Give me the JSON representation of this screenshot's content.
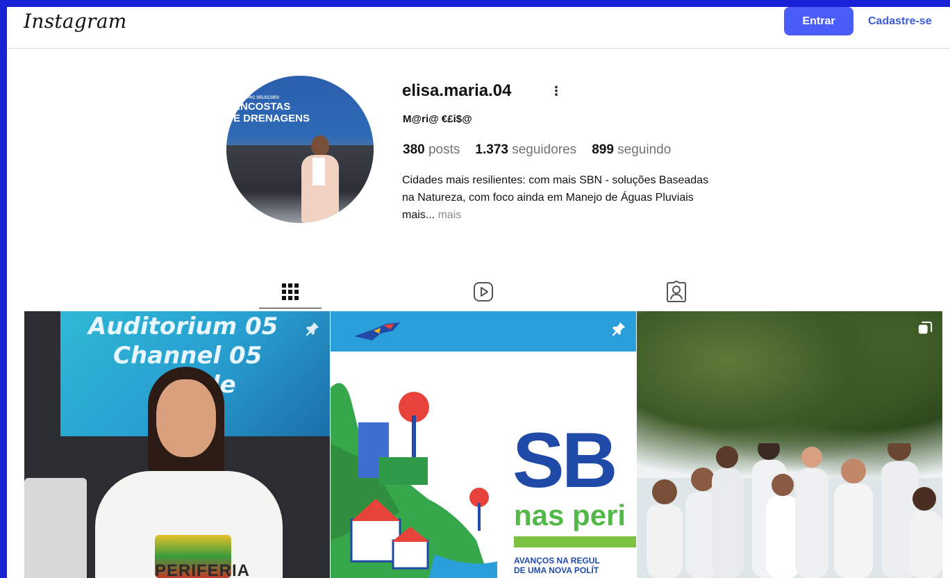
{
  "header": {
    "logo": "Instagram",
    "login_label": "Entrar",
    "signup_label": "Cadastre-se"
  },
  "profile": {
    "username": "elisa.maria.04",
    "more_label": "⋮",
    "full_name": "M@ri@ €£i$@",
    "stats": {
      "posts_count": "380",
      "posts_label": "posts",
      "followers_count": "1.373",
      "followers_label": "seguidores",
      "following_count": "899",
      "following_label": "seguindo"
    },
    "bio": {
      "line1": "Cidades mais resilientes: com mais SBN - soluções Baseadas",
      "line2": "na Natureza, com foco ainda em Manejo de Águas Pluviais",
      "line3": "mais...",
      "more_link": "mais"
    },
    "avatar_sign": {
      "small": "NOVO PAC SELEÇÕES",
      "line1": "ENCOSTAS",
      "line2": "E DRENAGENS"
    }
  },
  "tabs": [
    {
      "icon": "grid-icon",
      "active": true
    },
    {
      "icon": "reels-icon",
      "active": false
    },
    {
      "icon": "tagged-icon",
      "active": false
    }
  ],
  "posts": [
    {
      "kind": "photo",
      "pinned": true,
      "screen_line1": "Auditorium 05",
      "screen_line2": "Channel 05",
      "screen_line3": "le",
      "shirt_text": "PERIFERIA"
    },
    {
      "kind": "graphic",
      "pinned": true,
      "headline": "SB",
      "subline": "nas peri",
      "caption_line1": "AVANÇOS NA REGUL",
      "caption_line2": "DE UMA NOVA POLÍT"
    },
    {
      "kind": "carousel",
      "pinned": false
    }
  ],
  "colors": {
    "outer_frame": "#1a22d6",
    "login_button": "#4a5df9",
    "signup_link": "#3b5bdb",
    "muted_text": "#737373",
    "sbn_blue": "#1f4aa8",
    "sbn_green": "#52b848"
  }
}
